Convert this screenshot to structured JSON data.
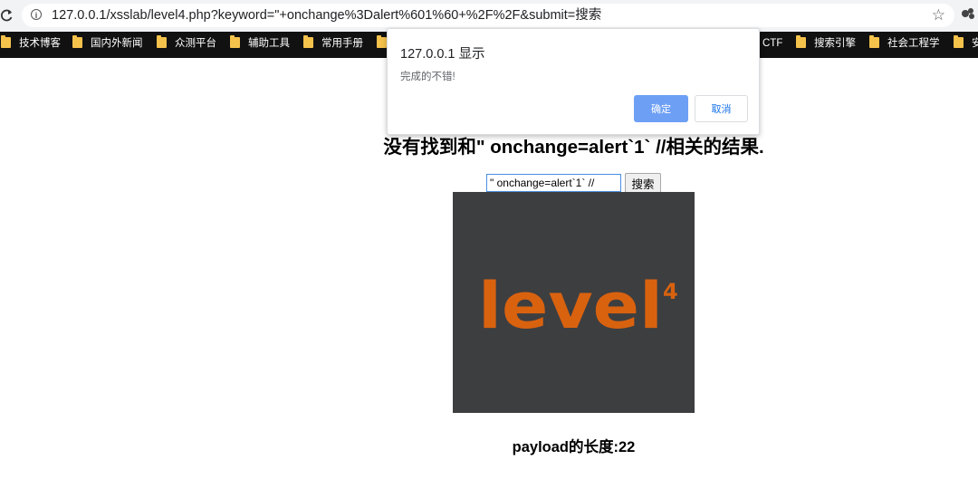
{
  "browser": {
    "url": "127.0.0.1/xsslab/level4.php?keyword=\"+onchange%3Dalert%601%60+%2F%2F&submit=搜索",
    "icons": [
      "reload-icon",
      "info-icon",
      "bookmark-star-icon",
      "extension-icon"
    ]
  },
  "bookmarks": [
    {
      "label": "技术博客"
    },
    {
      "label": "国内外新闻"
    },
    {
      "label": "众测平台"
    },
    {
      "label": "辅助工具"
    },
    {
      "label": "常用手册"
    },
    {
      "label": ""
    },
    {
      "label": "CTF"
    },
    {
      "label": "搜索引擎"
    },
    {
      "label": "社会工程学"
    },
    {
      "label": "安"
    }
  ],
  "dialog": {
    "title": "127.0.0.1 显示",
    "message": "完成的不错!",
    "ok_label": "确定",
    "cancel_label": "取消"
  },
  "page": {
    "heading": "没有找到和\" onchange=alert`1` //相关的结果.",
    "search_value": "\" onchange=alert`1` //",
    "search_button": "搜索",
    "logo_text": "level",
    "logo_superscript": "4",
    "payload_length": "payload的长度:22"
  },
  "colors": {
    "logo_orange": "#d9620f",
    "image_background": "#3d3e40",
    "ok_button": "#6da0f5",
    "bookmarks_bar": "#111111"
  }
}
